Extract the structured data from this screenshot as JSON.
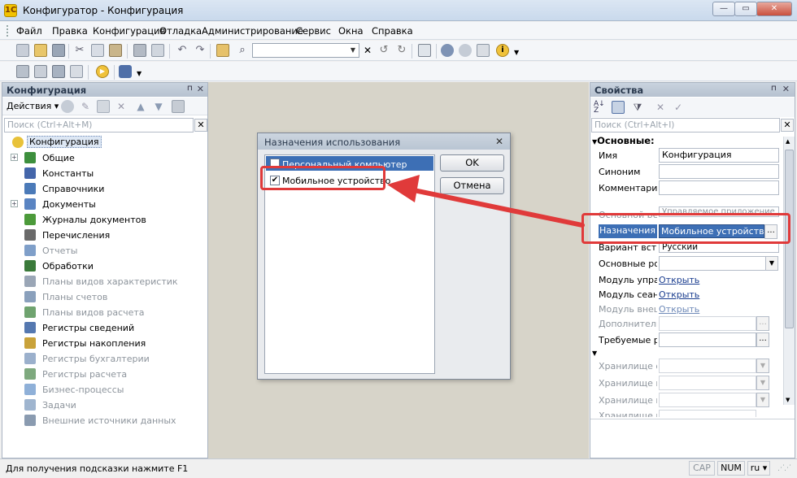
{
  "window": {
    "title": "Конфигуратор - Конфигурация",
    "minimize": "—",
    "restore": "▭",
    "close": "✕"
  },
  "menu": [
    "Файл",
    "Правка",
    "Конфигурация",
    "Отладка",
    "Администрирование",
    "Сервис",
    "Окна",
    "Справка"
  ],
  "left_panel": {
    "title": "Конфигурация",
    "actions": "Действия ▾",
    "search_placeholder": "Поиск (Ctrl+Alt+M)",
    "items": [
      {
        "label": "Конфигурация",
        "icon": "configuration-icon",
        "color": "#e8c23a",
        "expandable": false,
        "dim": false,
        "selected": true
      },
      {
        "label": "Общие",
        "icon": "common-icon",
        "color": "#3d8f3d",
        "expandable": true,
        "dim": false
      },
      {
        "label": "Константы",
        "icon": "constants-icon",
        "color": "#4466aa",
        "expandable": false,
        "dim": false
      },
      {
        "label": "Справочники",
        "icon": "catalogs-icon",
        "color": "#4b7ab8",
        "expandable": false,
        "dim": false
      },
      {
        "label": "Документы",
        "icon": "documents-icon",
        "color": "#5a84c2",
        "expandable": true,
        "dim": false
      },
      {
        "label": "Журналы документов",
        "icon": "journals-icon",
        "color": "#4c9a3a",
        "expandable": false,
        "dim": false
      },
      {
        "label": "Перечисления",
        "icon": "enums-icon",
        "color": "#6a6a6a",
        "expandable": false,
        "dim": false
      },
      {
        "label": "Отчеты",
        "icon": "reports-icon",
        "color": "#7f9fc9",
        "expandable": false,
        "dim": true
      },
      {
        "label": "Обработки",
        "icon": "dataprocessors-icon",
        "color": "#3a7a3a",
        "expandable": false,
        "dim": false
      },
      {
        "label": "Планы видов характеристик",
        "icon": "chart-types-icon",
        "color": "#9aa6b6",
        "expandable": false,
        "dim": true
      },
      {
        "label": "Планы счетов",
        "icon": "chart-accounts-icon",
        "color": "#8aa0bc",
        "expandable": false,
        "dim": true
      },
      {
        "label": "Планы видов расчета",
        "icon": "calc-types-icon",
        "color": "#6fa36f",
        "expandable": false,
        "dim": true
      },
      {
        "label": "Регистры сведений",
        "icon": "info-registers-icon",
        "color": "#5578b0",
        "expandable": false,
        "dim": false
      },
      {
        "label": "Регистры накопления",
        "icon": "accum-registers-icon",
        "color": "#c9a23a",
        "expandable": false,
        "dim": false
      },
      {
        "label": "Регистры бухгалтерии",
        "icon": "account-registers-icon",
        "color": "#9bb0cc",
        "expandable": false,
        "dim": true
      },
      {
        "label": "Регистры расчета",
        "icon": "calc-registers-icon",
        "color": "#7ea97e",
        "expandable": false,
        "dim": true
      },
      {
        "label": "Бизнес-процессы",
        "icon": "business-process-icon",
        "color": "#8fb0d8",
        "expandable": false,
        "dim": true
      },
      {
        "label": "Задачи",
        "icon": "tasks-icon",
        "color": "#9fb5cf",
        "expandable": false,
        "dim": true
      },
      {
        "label": "Внешние источники данных",
        "icon": "external-sources-icon",
        "color": "#8a9bb0",
        "expandable": false,
        "dim": true
      }
    ]
  },
  "dialog": {
    "title": "Назначения использования",
    "close": "✕",
    "options": [
      {
        "label": "Персональный компьютер",
        "checked": false
      },
      {
        "label": "Мобильное устройство",
        "checked": true
      }
    ],
    "ok": "OK",
    "cancel": "Отмена"
  },
  "right_panel": {
    "title": "Свойства",
    "search_placeholder": "Поиск (Ctrl+Alt+I)",
    "section": "Основные:",
    "rows": [
      {
        "name": "Имя",
        "value": "Конфигурация",
        "dim": false
      },
      {
        "name": "Синоним",
        "value": "",
        "dim": false
      },
      {
        "name": "Комментарий",
        "value": "",
        "dim": false
      }
    ],
    "partial_row": {
      "name": "Основной реж",
      "value": "Управляемое приложение"
    },
    "purpose": {
      "name": "Назначения и",
      "value": "Мобильное устройство",
      "dots": "..."
    },
    "lang": {
      "name": "Вариант встро",
      "value": "Русский"
    },
    "roles": {
      "name": "Основные рол"
    },
    "links": [
      {
        "name": "Модуль управ",
        "value": "Открыть",
        "dim": false
      },
      {
        "name": "Модуль сеанс",
        "value": "Открыть",
        "dim": false
      },
      {
        "name": "Модуль внешн",
        "value": "Открыть",
        "dim": true
      }
    ],
    "extra": [
      {
        "name": "Дополнительн",
        "dim": true
      },
      {
        "name": "Требуемые ра",
        "dim": false
      }
    ],
    "storage": [
      "Хранилище об",
      "Хранилище по",
      "Хранилище ва",
      "Хранилище на"
    ]
  },
  "status": {
    "hint": "Для получения подсказки нажмите F1",
    "cap": "CAP",
    "num": "NUM",
    "lang": "ru ▾"
  },
  "colors": {
    "highlight": "#e03a3a",
    "selection": "#3d6fb5"
  }
}
